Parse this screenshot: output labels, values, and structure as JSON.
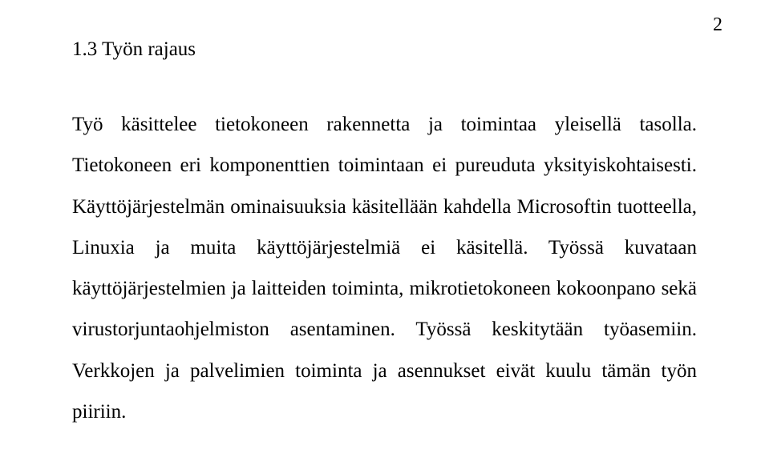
{
  "page": {
    "number": "2"
  },
  "heading": "1.3 Työn rajaus",
  "paragraph": "Työ käsittelee tietokoneen rakennetta ja toimintaa yleisellä tasolla. Tietokoneen eri komponenttien toimintaan ei pureuduta yksityiskohtaisesti. Käyttöjärjestelmän ominaisuuksia käsitellään kahdella Microsoftin tuotteella, Linuxia ja muita käyttöjärjestelmiä ei käsitellä. Työssä kuvataan käyttöjärjestelmien ja laitteiden toiminta, mikrotietokoneen kokoonpano sekä virustorjuntaohjelmiston asentaminen. Työssä keskitytään työasemiin. Verkkojen ja palvelimien toiminta ja asennukset eivät kuulu tämän työn piiriin."
}
